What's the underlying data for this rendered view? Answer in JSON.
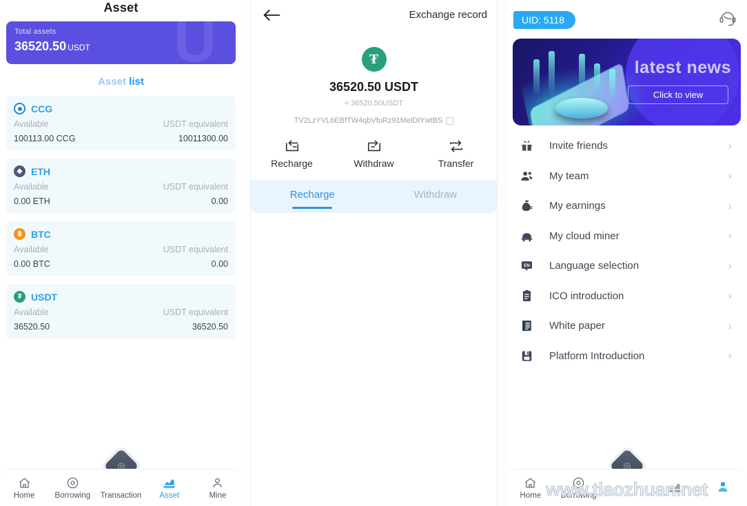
{
  "left": {
    "title": "Asset",
    "total": {
      "label": "Total assets",
      "value": "36520.50",
      "unit": "USDT",
      "watermark": "U",
      "bg": "#5b4fe0"
    },
    "list_heading": {
      "part1": "Asset",
      "part2": "list"
    },
    "column_labels": {
      "available": "Available",
      "equivalent": "USDT equivalent"
    },
    "coins": [
      {
        "icon": "ccg-coin-icon",
        "symbol": "CCG",
        "available_label": "Available",
        "equivalent_label": "USDT equivalent",
        "available": "100113.00  CCG",
        "equivalent": "10011300.00",
        "color": "#1f86d8"
      },
      {
        "icon": "eth-coin-icon",
        "symbol": "ETH",
        "available_label": "Available",
        "equivalent_label": "USDT equivalent",
        "available": "0.00  ETH",
        "equivalent": "0.00",
        "color": "#4a5a75"
      },
      {
        "icon": "btc-coin-icon",
        "symbol": "BTC",
        "available_label": "Available",
        "equivalent_label": "USDT equivalent",
        "available": "0.00  BTC",
        "equivalent": "0.00",
        "color": "#f7931a"
      },
      {
        "icon": "usdt-coin-icon",
        "symbol": "USDT",
        "available_label": "Available",
        "equivalent_label": "USDT equivalent",
        "available": "36520.50",
        "equivalent": "36520.50",
        "color": "#26a17b"
      }
    ],
    "tabbar": [
      {
        "icon": "home-icon",
        "label": "Home",
        "active": false
      },
      {
        "icon": "borrowing-icon",
        "label": "Borrowing",
        "active": false
      },
      {
        "icon": "transaction-icon",
        "label": "Transaction",
        "active": false
      },
      {
        "icon": "asset-chart-icon",
        "label": "Asset",
        "active": true
      },
      {
        "icon": "mine-person-icon",
        "label": "Mine",
        "active": false
      }
    ],
    "center_button": "diamond-logo"
  },
  "middle": {
    "back": "back-arrow-icon",
    "title": "Exchange record",
    "coin_icon": "usdt-icon",
    "amount": "36520.50 USDT",
    "approx": "≈ 36520.50USDT",
    "address": "TV2LzYVL6EBfTW4qbVfuRz91MeiDtYwtBS",
    "copy_icon": "copy-icon",
    "actions": [
      {
        "icon": "recharge-icon",
        "label": "Recharge"
      },
      {
        "icon": "withdraw-icon",
        "label": "Withdraw"
      },
      {
        "icon": "transfer-icon",
        "label": "Transfer"
      }
    ],
    "tabs": [
      {
        "label": "Recharge",
        "active": true
      },
      {
        "label": "Withdraw",
        "active": false
      }
    ],
    "accent": "#2f8fe0"
  },
  "right": {
    "uid": "UID: 5118",
    "service_icon": "customer-service-icon",
    "banner": {
      "title": "latest news",
      "button": "Click to view"
    },
    "menu": [
      {
        "icon": "gift-icon",
        "label": "Invite friends"
      },
      {
        "icon": "team-icon",
        "label": "My team"
      },
      {
        "icon": "money-bag-icon",
        "label": "My earnings"
      },
      {
        "icon": "cloud-miner-icon",
        "label": "My cloud miner"
      },
      {
        "icon": "language-icon",
        "label": "Language selection"
      },
      {
        "icon": "ico-document-icon",
        "label": "ICO introduction"
      },
      {
        "icon": "white-paper-icon",
        "label": "White paper"
      },
      {
        "icon": "platform-intro-icon",
        "label": "Platform Introduction"
      }
    ],
    "chevron": "›",
    "tabbar": [
      {
        "icon": "home-icon",
        "label": "Home",
        "active": false
      },
      {
        "icon": "borrowing-icon",
        "label": "Borrowing",
        "active": false
      },
      {
        "icon": "transaction-icon",
        "label": "",
        "active": false
      },
      {
        "icon": "asset-chart-icon",
        "label": "",
        "active": false
      },
      {
        "icon": "mine-person-icon",
        "label": "",
        "active": true
      }
    ],
    "center_button": "diamond-logo",
    "watermark": "www.tiaozhuan.net"
  }
}
